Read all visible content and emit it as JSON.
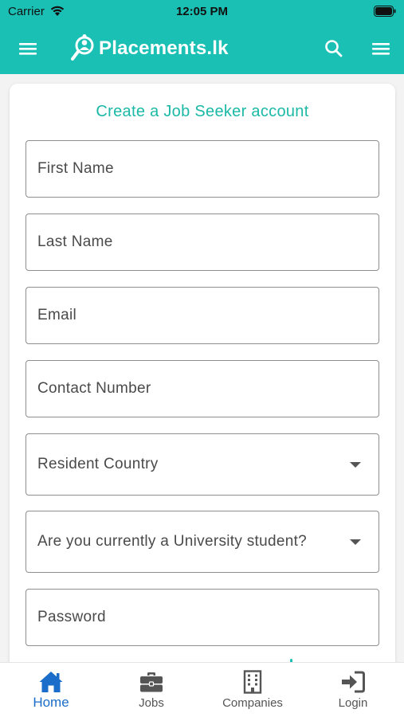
{
  "status_bar": {
    "carrier": "Carrier",
    "time": "12:05 PM"
  },
  "header": {
    "logo_text": "Placements.lk",
    "background_color": "#1bc0b4",
    "icons": [
      "menu-icon",
      "search-icon",
      "menu-icon"
    ]
  },
  "form": {
    "title": "Create a Job Seeker account",
    "title_color": "#1bb9a6",
    "fields": [
      {
        "placeholder": "First Name",
        "value": ""
      },
      {
        "placeholder": "Last Name",
        "value": ""
      },
      {
        "placeholder": "Email",
        "value": ""
      },
      {
        "placeholder": "Contact Number",
        "value": ""
      },
      {
        "placeholder": "Resident Country",
        "type": "select",
        "value": ""
      },
      {
        "placeholder": "Are you currently a University student?",
        "type": "select",
        "value": ""
      },
      {
        "placeholder": "Password",
        "value": ""
      }
    ]
  },
  "tab_bar": {
    "active_color": "#1a6dc9",
    "tabs": [
      {
        "label": "Home",
        "icon": "home-icon",
        "active": true
      },
      {
        "label": "Jobs",
        "icon": "briefcase-icon",
        "active": false
      },
      {
        "label": "Companies",
        "icon": "building-icon",
        "active": false
      },
      {
        "label": "Login",
        "icon": "login-icon",
        "active": false
      }
    ]
  }
}
